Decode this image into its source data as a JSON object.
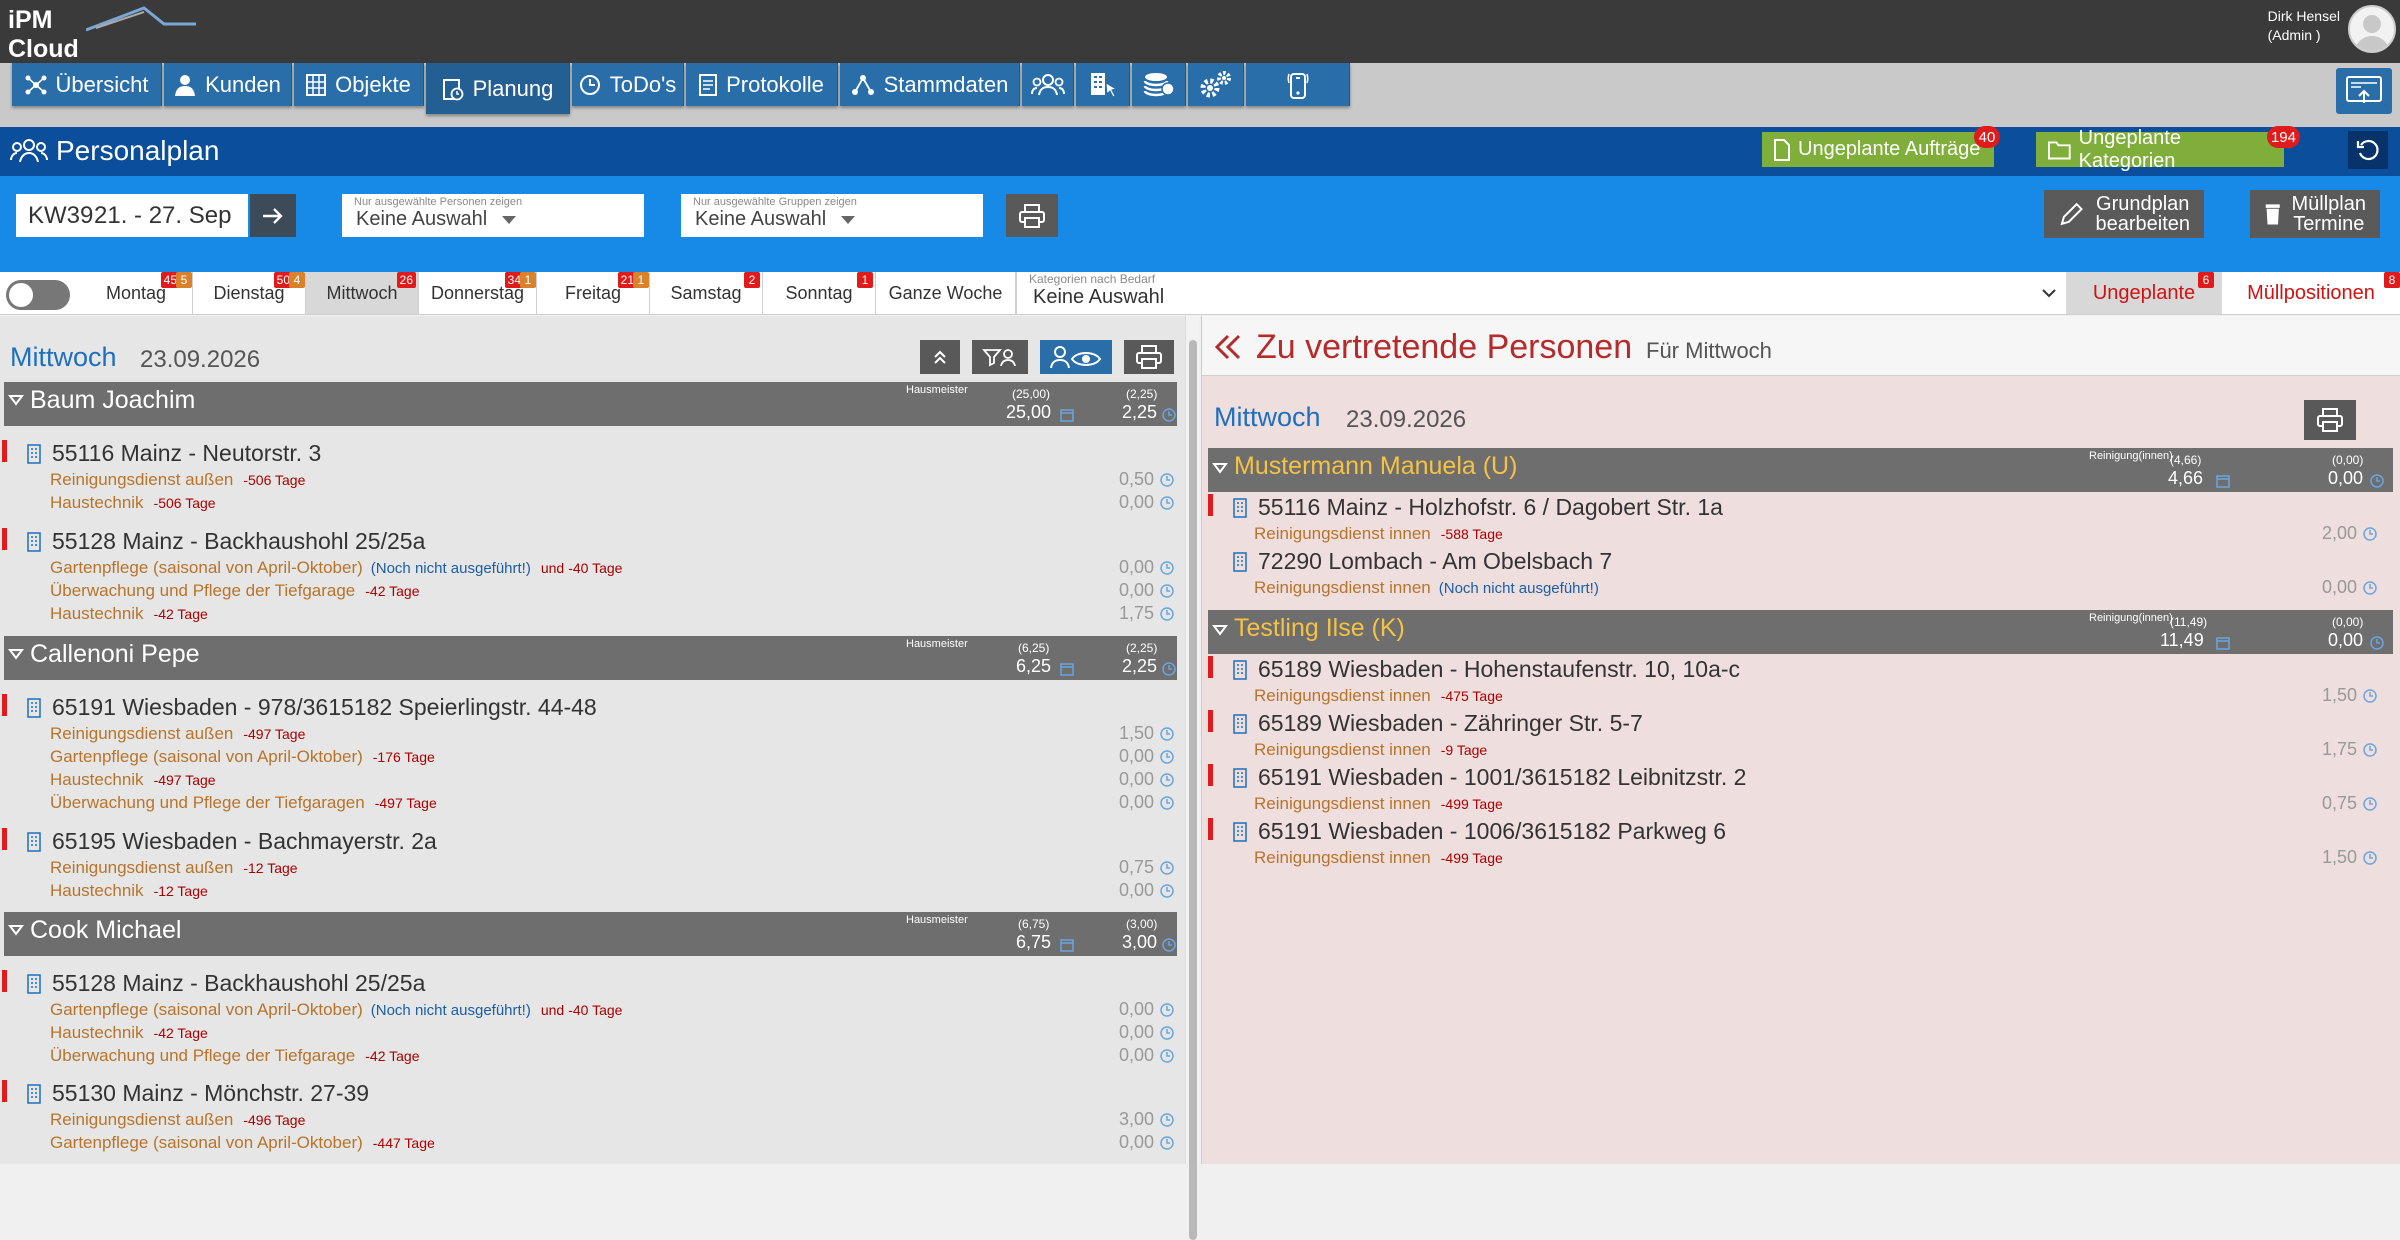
{
  "app": {
    "logo_line1": "iPM",
    "logo_line2": "Cloud",
    "user_name": "Dirk Hensel",
    "user_role": "(Admin )"
  },
  "nav": {
    "items": [
      {
        "label": "Übersicht",
        "icon": "network-icon"
      },
      {
        "label": "Kunden",
        "icon": "user-icon"
      },
      {
        "label": "Objekte",
        "icon": "building-grid-icon"
      },
      {
        "label": "Planung",
        "icon": "clipboard-clock-icon",
        "active": true
      },
      {
        "label": "ToDo's",
        "icon": "clock-icon"
      },
      {
        "label": "Protokolle",
        "icon": "document-icon"
      },
      {
        "label": "Stammdaten",
        "icon": "hierarchy-icon"
      }
    ],
    "icon_items": [
      "group-icon",
      "building-cursor-icon",
      "coins-icon",
      "gears-icon",
      "mobile-icon"
    ]
  },
  "header": {
    "title": "Personalplan",
    "btn_orders": "Ungeplante Aufträge",
    "btn_orders_count": "40",
    "btn_categories": "Ungeplante Kategorien",
    "btn_categories_count": "194"
  },
  "filter": {
    "week": "KW39",
    "range": "21. - 27. Sep",
    "persons_label": "Nur ausgewählte Personen zeigen",
    "persons_value": "Keine Auswahl",
    "groups_label": "Nur ausgewählte Gruppen zeigen",
    "groups_value": "Keine Auswahl",
    "btn_grundplan_1": "Grundplan",
    "btn_grundplan_2": "bearbeiten",
    "btn_muellplan_1": "Müllplan",
    "btn_muellplan_2": "Termine"
  },
  "days": [
    {
      "label": "Montag",
      "badge_red": "45",
      "badge_orange": "5"
    },
    {
      "label": "Dienstag",
      "badge_red": "50",
      "badge_orange": "4"
    },
    {
      "label": "Mittwoch",
      "badge_red": "26",
      "badge_orange": ""
    },
    {
      "label": "Donnerstag",
      "badge_red": "34",
      "badge_orange": "1"
    },
    {
      "label": "Freitag",
      "badge_red": "21",
      "badge_orange": "1"
    },
    {
      "label": "Samstag",
      "badge_red": "2",
      "badge_orange": ""
    },
    {
      "label": "Sonntag",
      "badge_red": "1",
      "badge_orange": ""
    },
    {
      "label": "Ganze Woche",
      "badge_red": "",
      "badge_orange": ""
    }
  ],
  "categories": {
    "label": "Kategorien nach Bedarf",
    "value": "Keine Auswahl"
  },
  "right_tabs": {
    "ungeplante": "Ungeplante",
    "ungeplante_count": "6",
    "muell": "Müllpositionen",
    "muell_count": "8"
  },
  "left": {
    "day": "Mittwoch",
    "date": "23.09.2026",
    "groups": [
      {
        "name": "Baum Joachim",
        "role": "Hausmeister",
        "p1": "(25,00)",
        "v1": "25,00",
        "p2": "(2,25)",
        "v2": "2,25",
        "objects": [
          {
            "name": "55116 Mainz - Neutorstr. 3",
            "services": [
              {
                "name": "Reinigungsdienst außen",
                "note": "",
                "days": "-506 Tage",
                "val": "0,50"
              },
              {
                "name": "Haustechnik",
                "note": "",
                "days": "-506 Tage",
                "val": "0,00"
              }
            ]
          },
          {
            "name": "55128 Mainz - Backhaushohl 25/25a",
            "services": [
              {
                "name": "Gartenpflege (saisonal von April-Oktober)",
                "note": "(Noch nicht ausgeführt!)",
                "mid": "und",
                "days": "-40 Tage",
                "val": "0,00"
              },
              {
                "name": "Überwachung und Pflege der Tiefgarage",
                "note": "",
                "days": "-42 Tage",
                "val": "0,00"
              },
              {
                "name": "Haustechnik",
                "note": "",
                "days": "-42 Tage",
                "val": "1,75"
              }
            ]
          }
        ]
      },
      {
        "name": "Callenoni Pepe",
        "role": "Hausmeister",
        "p1": "(6,25)",
        "v1": "6,25",
        "p2": "(2,25)",
        "v2": "2,25",
        "objects": [
          {
            "name": "65191 Wiesbaden - 978/3615182 Speierlingstr. 44-48",
            "services": [
              {
                "name": "Reinigungsdienst außen",
                "note": "",
                "days": "-497 Tage",
                "val": "1,50"
              },
              {
                "name": "Gartenpflege (saisonal von April-Oktober)",
                "note": "",
                "days": "-176 Tage",
                "val": "0,00"
              },
              {
                "name": "Haustechnik",
                "note": "",
                "days": "-497 Tage",
                "val": "0,00"
              },
              {
                "name": "Überwachung und Pflege der Tiefgaragen",
                "note": "",
                "days": "-497 Tage",
                "val": "0,00"
              }
            ]
          },
          {
            "name": "65195 Wiesbaden - Bachmayerstr. 2a",
            "services": [
              {
                "name": "Reinigungsdienst außen",
                "note": "",
                "days": "-12 Tage",
                "val": "0,75"
              },
              {
                "name": "Haustechnik",
                "note": "",
                "days": "-12 Tage",
                "val": "0,00"
              }
            ]
          }
        ]
      },
      {
        "name": "Cook Michael",
        "role": "Hausmeister",
        "p1": "(6,75)",
        "v1": "6,75",
        "p2": "(3,00)",
        "v2": "3,00",
        "objects": [
          {
            "name": "55128 Mainz - Backhaushohl 25/25a",
            "services": [
              {
                "name": "Gartenpflege (saisonal von April-Oktober)",
                "note": "(Noch nicht ausgeführt!)",
                "mid": "und",
                "days": "-40 Tage",
                "val": "0,00"
              },
              {
                "name": "Haustechnik",
                "note": "",
                "days": "-42 Tage",
                "val": "0,00"
              },
              {
                "name": "Überwachung und Pflege der Tiefgarage",
                "note": "",
                "days": "-42 Tage",
                "val": "0,00"
              }
            ]
          },
          {
            "name": "55130 Mainz - Mönchstr. 27-39",
            "services": [
              {
                "name": "Reinigungsdienst außen",
                "note": "",
                "days": "-496 Tage",
                "val": "3,00"
              },
              {
                "name": "Gartenpflege (saisonal von April-Oktober)",
                "note": "",
                "days": "-447 Tage",
                "val": "0,00"
              }
            ]
          }
        ]
      }
    ]
  },
  "right": {
    "title": "Zu vertretende Personen",
    "subtitle": "Für Mittwoch",
    "day": "Mittwoch",
    "date": "23.09.2026",
    "groups": [
      {
        "name": "Mustermann Manuela (U)",
        "role": "Reinigung(innen)",
        "p1": "(4,66)",
        "v1": "4,66",
        "p2": "(0,00)",
        "v2": "0,00",
        "objects": [
          {
            "name": "55116 Mainz - Holzhofstr. 6 / Dagobert Str. 1a",
            "bar": true,
            "services": [
              {
                "name": "Reinigungsdienst innen",
                "note": "",
                "days": "-588 Tage",
                "val": "2,00"
              }
            ]
          },
          {
            "name": "72290 Lombach - Am Obelsbach 7",
            "bar": false,
            "services": [
              {
                "name": "Reinigungsdienst innen",
                "note": "(Noch nicht ausgeführt!)",
                "days": "",
                "val": "0,00"
              }
            ]
          }
        ]
      },
      {
        "name": "Testling Ilse (K)",
        "role": "Reinigung(innen)",
        "p1": "(11,49)",
        "v1": "11,49",
        "p2": "(0,00)",
        "v2": "0,00",
        "objects": [
          {
            "name": "65189 Wiesbaden - Hohenstaufenstr. 10, 10a-c",
            "bar": true,
            "services": [
              {
                "name": "Reinigungsdienst innen",
                "note": "",
                "days": "-475 Tage",
                "val": "1,50"
              }
            ]
          },
          {
            "name": "65189 Wiesbaden - Zähringer Str. 5-7",
            "bar": true,
            "services": [
              {
                "name": "Reinigungsdienst innen",
                "note": "",
                "days": "-9 Tage",
                "val": "1,75"
              }
            ]
          },
          {
            "name": "65191 Wiesbaden - 1001/3615182 Leibnitzstr. 2",
            "bar": true,
            "services": [
              {
                "name": "Reinigungsdienst innen",
                "note": "",
                "days": "-499 Tage",
                "val": "0,75"
              }
            ]
          },
          {
            "name": "65191 Wiesbaden - 1006/3615182 Parkweg 6",
            "bar": true,
            "services": [
              {
                "name": "Reinigungsdienst innen",
                "note": "",
                "days": "-499 Tage",
                "val": "1,50"
              }
            ]
          }
        ]
      }
    ]
  },
  "colors": {
    "nav": "#2a6ea9",
    "header": "#0b4f9c",
    "filter": "#1789e6",
    "badge": "#e01b1b",
    "green": "#7fae3a",
    "service": "#b8742a",
    "alert_bar": "#e01b1b"
  }
}
